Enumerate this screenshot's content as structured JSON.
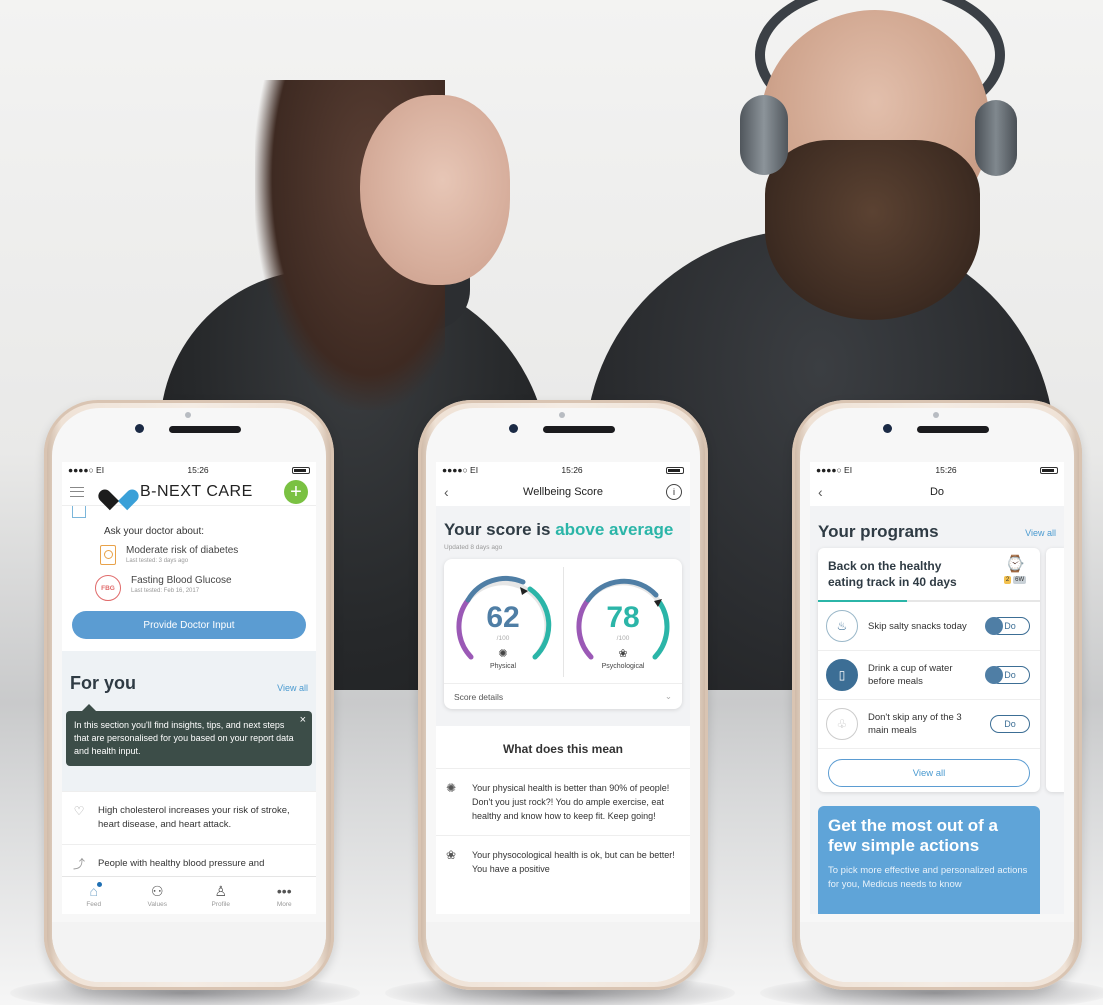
{
  "phone1": {
    "status": {
      "carrier": "●●●●○ EI",
      "time": "15:26"
    },
    "brand": "B-NEXT CARE",
    "plus_label": "+",
    "ask_label": "Ask your doctor about:",
    "items": [
      {
        "title": "Moderate risk of diabetes",
        "sub": "Last tested: 3 days ago"
      },
      {
        "title": "Fasting Blood Glucose",
        "sub": "Last tested: Feb 16, 2017",
        "badge": "FBG"
      }
    ],
    "primary_button": "Provide Doctor Input",
    "foryou": {
      "title": "For you",
      "view_all": "View all",
      "tooltip": "In this section you'll find insights, tips, and next steps that are personalised for you based on your report data and health input.",
      "tooltip_close": "×"
    },
    "feed": [
      {
        "text": "High cholesterol increases your risk of stroke, heart disease, and heart attack."
      },
      {
        "text": "People with healthy blood pressure and"
      }
    ],
    "tabs": [
      {
        "label": "Feed",
        "icon": "home-icon"
      },
      {
        "label": "Values",
        "icon": "values-icon"
      },
      {
        "label": "Profile",
        "icon": "profile-icon"
      },
      {
        "label": "More",
        "icon": "more-icon"
      }
    ]
  },
  "phone2": {
    "status": {
      "carrier": "●●●●○ EI",
      "time": "15:26"
    },
    "nav_title": "Wellbeing Score",
    "headline_prefix": "Your score is ",
    "headline_highlight": "above average",
    "updated": "Updated 8 days ago",
    "physical": {
      "value": "62",
      "den": "/100",
      "label": "Physical",
      "level": 0.62,
      "color": "#4f7ea5"
    },
    "psychological": {
      "value": "78",
      "den": "/100",
      "label": "Psychological",
      "level": 0.78,
      "color": "#2bb5a8"
    },
    "score_details": "Score details",
    "what_mean": "What does this mean",
    "means": [
      {
        "text": "Your physical health is better than 90% of people! Don't you just rock?! You do ample exercise, eat healthy and know how to keep fit. Keep going!"
      },
      {
        "text": "Your physocological health is ok, but can be better! You have a positive"
      }
    ]
  },
  "phone3": {
    "status": {
      "carrier": "●●●●○ EI",
      "time": "15:26"
    },
    "nav_title": "Do",
    "programs_title": "Your programs",
    "view_all": "View all",
    "program": {
      "title": "Back on the healthy eating track in 40 days",
      "badge_a": "2",
      "badge_b": "6W",
      "progress": 0.4
    },
    "tasks": [
      {
        "text": "Skip salty snacks today",
        "toggle": "Do",
        "on": true
      },
      {
        "text": "Drink a cup of water before meals",
        "toggle": "Do",
        "on": true
      },
      {
        "text": "Don't skip any of the 3 main meals",
        "toggle": "Do",
        "on": false
      }
    ],
    "view_all_button": "View all",
    "promo": {
      "title": "Get the most out of a few simple actions",
      "text": "To pick more effective and personalized actions for you, Medicus needs to know"
    }
  }
}
